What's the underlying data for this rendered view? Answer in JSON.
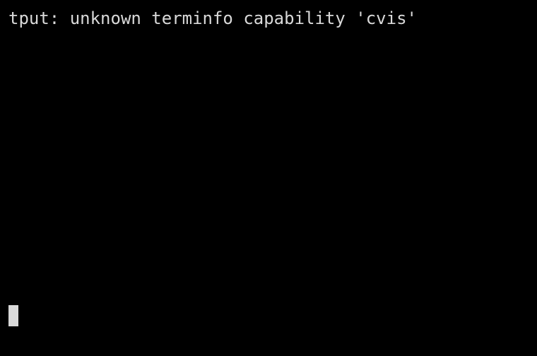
{
  "terminal": {
    "output_lines": [
      "tput: unknown terminfo capability 'cvis'"
    ],
    "colors": {
      "background": "#000000",
      "foreground": "#d9d9d9",
      "cursor": "#d9d9d9"
    }
  }
}
